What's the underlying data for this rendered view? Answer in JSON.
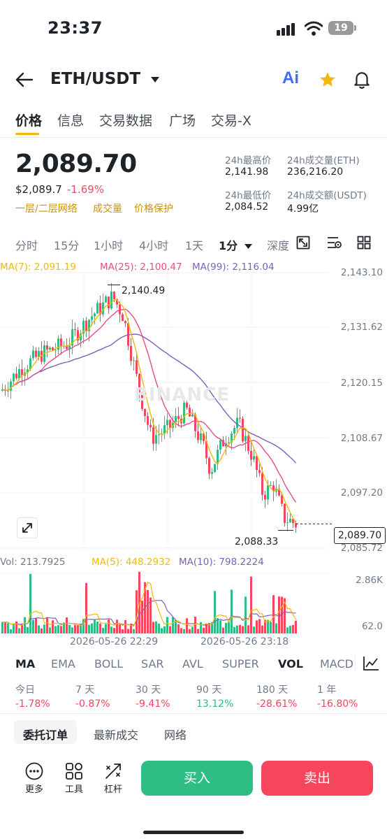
{
  "status_bar": {
    "time": "23:37",
    "battery": "19"
  },
  "header": {
    "pair": "ETH/USDT",
    "ai_label": "Ai"
  },
  "tabs": [
    "价格",
    "信息",
    "交易数据",
    "广场",
    "交易-X"
  ],
  "price": {
    "last": "2,089.70",
    "usd": "$2,089.7",
    "change": "-1.69%",
    "tags": [
      "一层/二层网络",
      "成交量",
      "价格保护"
    ]
  },
  "stats": {
    "high_label": "24h最高价",
    "high": "2,141.98",
    "vol_eth_label": "24h成交量(ETH)",
    "vol_eth": "236,216.20",
    "low_label": "24h最低价",
    "low": "2,084.52",
    "vol_usdt_label": "24h成交额(USDT)",
    "vol_usdt": "4.99亿"
  },
  "intervals": [
    "分时",
    "15分",
    "1小时",
    "4小时",
    "1天",
    "1分",
    "深度"
  ],
  "ma": {
    "ma7": "MA(7): 2,091.19",
    "ma25": "MA(25): 2,100.47",
    "ma99": "MA(99): 2,116.04"
  },
  "colors": {
    "up": "#2ebd85",
    "down": "#f6465d",
    "ma7": "#f0b90b",
    "ma25": "#e84a8b",
    "ma99": "#7e5fb8",
    "accent": "#f0b90b"
  },
  "chart": {
    "y_ticks": [
      "2,143.10",
      "2,131.62",
      "2,120.15",
      "2,108.67",
      "2,097.20",
      "2,085.72"
    ],
    "high_marker": "2,140.49",
    "low_marker": "2,088.33",
    "current_price": "2,089.70",
    "watermark": "BINANCE"
  },
  "volume": {
    "vol": "Vol: 213.7925",
    "ma5": "MA(5): 448.2932",
    "ma10": "MA(10): 798.2224",
    "y_top": "2.86K",
    "y_bottom": "62.0",
    "x_labels": [
      "2026-05-26 22:29",
      "2026-05-26 23:18"
    ]
  },
  "chart_data": {
    "type": "candlestick",
    "ylim": [
      2085.72,
      2143.1
    ],
    "high": 2140.49,
    "low": 2088.33,
    "last": 2089.7
  },
  "indicators": [
    "MA",
    "EMA",
    "BOLL",
    "SAR",
    "AVL",
    "SUPER",
    "VOL",
    "MACD"
  ],
  "performance": [
    {
      "label": "今日",
      "value": "-1.78%",
      "dir": "down"
    },
    {
      "label": "7 天",
      "value": "-0.87%",
      "dir": "down"
    },
    {
      "label": "30 天",
      "value": "-9.41%",
      "dir": "down"
    },
    {
      "label": "90 天",
      "value": "13.12%",
      "dir": "up"
    },
    {
      "label": "180 天",
      "value": "-28.61%",
      "dir": "down"
    },
    {
      "label": "1 年",
      "value": "-16.80%",
      "dir": "down"
    }
  ],
  "order_tabs": [
    "委托订单",
    "最新成交",
    "网络"
  ],
  "tools": [
    "更多",
    "工具",
    "杠杆"
  ],
  "actions": {
    "buy": "买入",
    "sell": "卖出"
  }
}
